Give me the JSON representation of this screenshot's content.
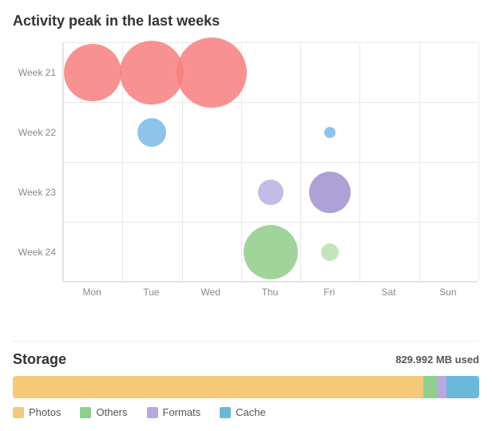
{
  "chart": {
    "title": "Activity peak in the last weeks",
    "rows": [
      "Week 21",
      "Week 22",
      "Week 23",
      "Week 24"
    ],
    "cols": [
      "Mon",
      "Tue",
      "Wed",
      "Thu",
      "Fri",
      "Sat",
      "Sun"
    ],
    "bubbles": [
      {
        "row": 0,
        "col": 0,
        "size": 72,
        "color": "#f77f7f"
      },
      {
        "row": 0,
        "col": 1,
        "size": 80,
        "color": "#f77f7f"
      },
      {
        "row": 0,
        "col": 2,
        "size": 88,
        "color": "#f77f7f"
      },
      {
        "row": 1,
        "col": 1,
        "size": 36,
        "color": "#7ab8e8"
      },
      {
        "row": 1,
        "col": 4,
        "size": 14,
        "color": "#7ab8e8"
      },
      {
        "row": 2,
        "col": 3,
        "size": 32,
        "color": "#b8b0e0"
      },
      {
        "row": 2,
        "col": 4,
        "size": 52,
        "color": "#a090d0"
      },
      {
        "row": 3,
        "col": 3,
        "size": 68,
        "color": "#90cc88"
      },
      {
        "row": 3,
        "col": 4,
        "size": 22,
        "color": "#b8e0b0"
      }
    ]
  },
  "storage": {
    "title": "Storage",
    "used_label": "829.992 MB used",
    "segments": [
      {
        "label": "Photos",
        "color": "#f5c97a",
        "percent": 88
      },
      {
        "label": "Others",
        "color": "#8fce8f",
        "percent": 3
      },
      {
        "label": "Formats",
        "color": "#b8a8e0",
        "percent": 2
      },
      {
        "label": "Cache",
        "color": "#6cb8d8",
        "percent": 7
      }
    ],
    "legend": [
      {
        "label": "Photos",
        "color": "#f5c97a"
      },
      {
        "label": "Others",
        "color": "#8fce8f"
      },
      {
        "label": "Formats",
        "color": "#b8a8e0"
      },
      {
        "label": "Cache",
        "color": "#6cb8d8"
      }
    ]
  }
}
